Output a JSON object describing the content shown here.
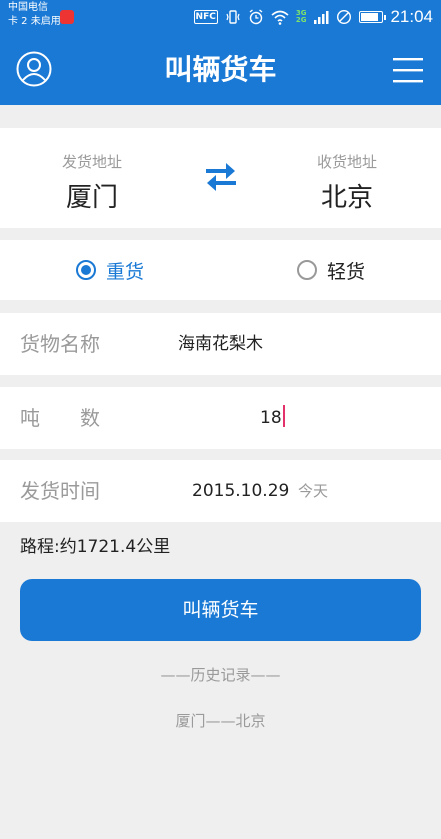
{
  "status_bar": {
    "carrier_line1": "中国电信",
    "carrier_line2": "卡 2 未启用",
    "nfc": "NFC",
    "network": "3G",
    "network2": "2G",
    "battery_level": 0.9,
    "time": "21:04"
  },
  "app_bar": {
    "title": "叫辆货车",
    "left_icon": "user-avatar-icon",
    "right_icon": "menu-icon"
  },
  "route": {
    "from_label": "发货地址",
    "from_city": "厦门",
    "to_label": "收货地址",
    "to_city": "北京",
    "swap_icon": "swap-arrows-icon"
  },
  "cargo_type": {
    "heavy_label": "重货",
    "light_label": "轻货",
    "selected": "heavy"
  },
  "form": {
    "goods_label": "货物名称",
    "goods_value": "海南花梨木",
    "tons_label": "吨　　数",
    "tons_value": "18",
    "time_label": "发货时间",
    "time_value": "2015.10.29",
    "time_hint": "今天"
  },
  "distance_text": "路程:约1721.4公里",
  "submit_label": "叫辆货车",
  "history": {
    "title": "——历史记录——",
    "items": [
      "厦门——北京"
    ]
  },
  "colors": {
    "primary": "#1a79d5",
    "background": "#efeff0",
    "muted_text": "#9a9a9a",
    "caret": "#e2316b"
  }
}
